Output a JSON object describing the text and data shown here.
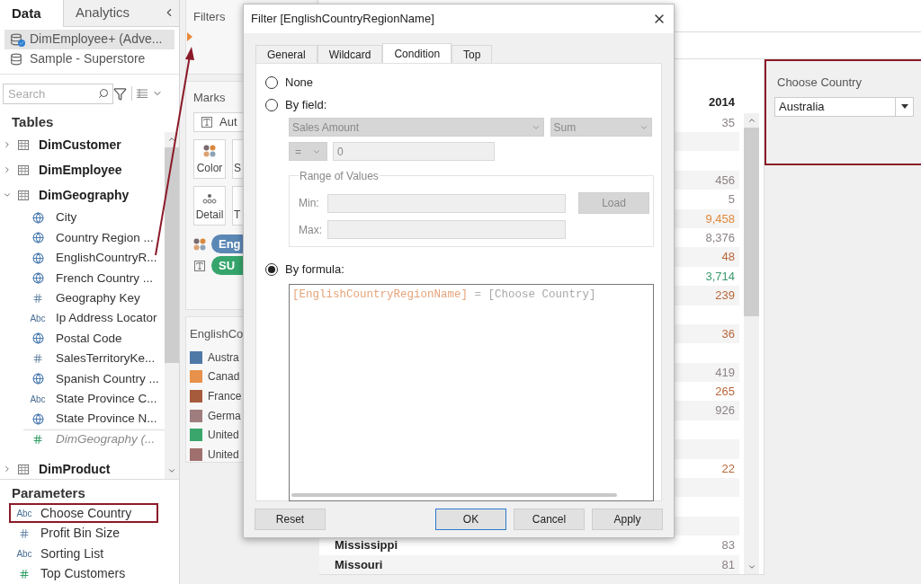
{
  "left_panel": {
    "tabs": [
      {
        "label": "Data",
        "selected": true
      },
      {
        "label": "Analytics",
        "selected": false
      }
    ],
    "data_sources": [
      {
        "name": "DimEmployee+ (Adve...",
        "selected": true,
        "kind": "primary"
      },
      {
        "name": "Sample - Superstore",
        "selected": false,
        "kind": "plain"
      }
    ],
    "search": {
      "placeholder": "Search"
    },
    "tables_heading": "Tables",
    "tables": [
      {
        "name": "DimCustomer",
        "expanded": false
      },
      {
        "name": "DimEmployee",
        "expanded": false
      },
      {
        "name": "DimGeography",
        "expanded": true,
        "children": [
          {
            "name": "City",
            "kind": "geo"
          },
          {
            "name": "Country Region ...",
            "kind": "geo"
          },
          {
            "name": "EnglishCountryR...",
            "kind": "geo"
          },
          {
            "name": "French Country ...",
            "kind": "geo"
          },
          {
            "name": "Geography Key",
            "kind": "number"
          },
          {
            "name": "Ip Address Locator",
            "kind": "string",
            "icon_text": "Abc"
          },
          {
            "name": "Postal Code",
            "kind": "geo"
          },
          {
            "name": "SalesTerritoryKe...",
            "kind": "number"
          },
          {
            "name": "Spanish Country ...",
            "kind": "geo"
          },
          {
            "name": "State Province C...",
            "kind": "string",
            "icon_text": "Abc"
          },
          {
            "name": "State Province N...",
            "kind": "geo"
          },
          {
            "name": "DimGeography (...",
            "kind": "count"
          }
        ]
      },
      {
        "name": "DimProduct",
        "expanded": false
      }
    ],
    "parameters_heading": "Parameters",
    "parameters": [
      {
        "name": "Choose Country",
        "kind": "string",
        "icon_text": "Abc",
        "highlighted": true
      },
      {
        "name": "Profit Bin Size",
        "kind": "number",
        "highlighted": false
      },
      {
        "name": "Sorting List",
        "kind": "string",
        "icon_text": "Abc",
        "highlighted": false
      },
      {
        "name": "Top Customers",
        "kind": "measure",
        "highlighted": false
      }
    ]
  },
  "shelves": {
    "filters_title": "Filters",
    "marks_title": "Marks",
    "mark_type": "Aut",
    "cards": [
      {
        "label": "Color",
        "kind": "color"
      },
      {
        "label": "S",
        "kind": "size"
      },
      {
        "label": "Detail",
        "kind": "detail"
      },
      {
        "label": "T",
        "kind": "tooltip"
      }
    ],
    "pills": [
      {
        "label": "Eng",
        "kind": "color",
        "color": "#5b87b5"
      },
      {
        "label": "SU",
        "kind": "text",
        "color": "#35a56c"
      }
    ],
    "legend": {
      "title": "EnglishCo",
      "items": [
        {
          "label": "Austra",
          "color": "#4e79a7"
        },
        {
          "label": "Canad",
          "color": "#e8914a"
        },
        {
          "label": "France",
          "color": "#a65b3c"
        },
        {
          "label": "Germa",
          "color": "#9f7d7e"
        },
        {
          "label": "United",
          "color": "#3aa66c"
        },
        {
          "label": "United",
          "color": "#a0706e"
        }
      ]
    }
  },
  "view": {
    "column_header": "2014",
    "rows": [
      {
        "kind": "value",
        "value": "35",
        "color": "#8c8283"
      },
      {
        "kind": "empty"
      },
      {
        "kind": "empty"
      },
      {
        "kind": "value",
        "value": "456",
        "color": "#8c8283"
      },
      {
        "kind": "value",
        "value": "5",
        "color": "#8c8283"
      },
      {
        "kind": "value",
        "value": "9,458",
        "color": "#e0883a"
      },
      {
        "kind": "value",
        "value": "8,376",
        "color": "#8c8283"
      },
      {
        "kind": "value",
        "value": "48",
        "color": "#b8673a"
      },
      {
        "kind": "value",
        "value": "3,714",
        "color": "#3a9a6e"
      },
      {
        "kind": "value",
        "value": "239",
        "color": "#b8673a"
      },
      {
        "kind": "empty"
      },
      {
        "kind": "value",
        "value": "36",
        "color": "#b8673a"
      },
      {
        "kind": "empty"
      },
      {
        "kind": "value",
        "value": "419",
        "color": "#8c8283"
      },
      {
        "kind": "value",
        "value": "265",
        "color": "#b8673a"
      },
      {
        "kind": "value",
        "value": "926",
        "color": "#8c8283"
      },
      {
        "kind": "empty"
      },
      {
        "kind": "empty"
      },
      {
        "kind": "value",
        "value": "22",
        "color": "#b8673a"
      },
      {
        "kind": "empty"
      },
      {
        "kind": "empty"
      },
      {
        "kind": "empty"
      },
      {
        "kind": "value",
        "state": "Mississippi",
        "value": "83",
        "color": "#8c8283"
      },
      {
        "kind": "value",
        "state": "Missouri",
        "value": "81",
        "color": "#8c8283"
      }
    ]
  },
  "parameter_control": {
    "title": "Choose Country",
    "value": "Australia",
    "highlighted": true
  },
  "dialog": {
    "title": "Filter [EnglishCountryRegionName]",
    "tabs": [
      {
        "label": "General",
        "selected": false
      },
      {
        "label": "Wildcard",
        "selected": false
      },
      {
        "label": "Condition",
        "selected": true
      },
      {
        "label": "Top",
        "selected": false
      }
    ],
    "options": [
      {
        "label": "None",
        "selected": false
      },
      {
        "label": "By field:",
        "selected": false
      },
      {
        "label": "By formula:",
        "selected": true
      }
    ],
    "by_field": {
      "disabled": true,
      "field": "Sales Amount",
      "aggregation": "Sum",
      "operator": "=",
      "value": "0",
      "range_title": "Range of Values",
      "min_label": "Min:",
      "max_label": "Max:",
      "load_button": "Load"
    },
    "formula": [
      {
        "text": "[EnglishCountryRegionName]",
        "kind": "field"
      },
      {
        "text": "=",
        "kind": "operator"
      },
      {
        "text": "[Choose Country]",
        "kind": "parameter"
      }
    ],
    "buttons": [
      {
        "label": "Reset",
        "default": false
      },
      {
        "label": "OK",
        "default": true
      },
      {
        "label": "Cancel",
        "default": false
      },
      {
        "label": "Apply",
        "default": false
      }
    ]
  }
}
